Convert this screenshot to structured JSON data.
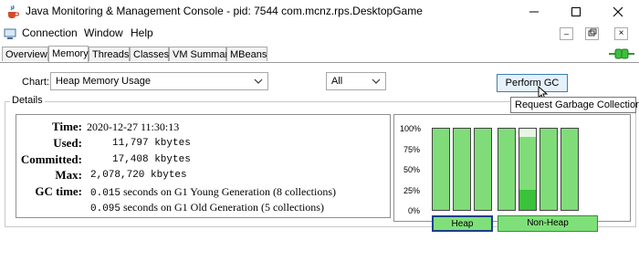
{
  "window": {
    "title": "Java Monitoring & Management Console - pid: 7544 com.mcnz.rps.DesktopGame",
    "icon": "java-cup-icon"
  },
  "menu": {
    "items": [
      "Connection",
      "Window",
      "Help"
    ]
  },
  "tabs": [
    "Overview",
    "Memory",
    "Threads",
    "Classes",
    "VM Summary",
    "MBeans"
  ],
  "active_tab": "Memory",
  "controls": {
    "chart_label": "Chart:",
    "chart_selected": "Heap Memory Usage",
    "range_selected": "All",
    "gc_button": "Perform GC",
    "tooltip": "Request Garbage Collection"
  },
  "details": {
    "legend": "Details",
    "time_label": "Time:",
    "time_value": "2020-12-27 11:30:13",
    "used_label": "Used:",
    "used_value": "11,797 kbytes",
    "committed_label": "Committed:",
    "committed_value": "17,408 kbytes",
    "max_label": "Max:",
    "max_value": "2,078,720 kbytes",
    "gctime_label": "GC time:",
    "gc_lines": [
      {
        "seconds": "0.015",
        "text": " seconds on G1 Young Generation (8 collections)"
      },
      {
        "seconds": "0.095",
        "text": " seconds on G1 Old Generation (5 collections)"
      }
    ]
  },
  "chart": {
    "y_ticks": [
      "100%",
      "75%",
      "50%",
      "25%",
      "0%"
    ],
    "heap_label": "Heap",
    "nonheap_label": "Non-Heap",
    "bars": [
      {
        "group": "heap",
        "committed_pct": 100,
        "used_pct": 0
      },
      {
        "group": "heap",
        "committed_pct": 100,
        "used_pct": 0
      },
      {
        "group": "heap",
        "committed_pct": 100,
        "used_pct": 0
      },
      {
        "group": "nonheap",
        "committed_pct": 100,
        "used_pct": 0
      },
      {
        "group": "nonheap",
        "committed_pct": 90,
        "used_pct": 25
      },
      {
        "group": "nonheap",
        "committed_pct": 100,
        "used_pct": 0
      },
      {
        "group": "nonheap",
        "committed_pct": 100,
        "used_pct": 0
      }
    ],
    "colors": {
      "committed": "#7fdc78",
      "used": "#39c23a",
      "background": "#e7f6e3"
    }
  }
}
